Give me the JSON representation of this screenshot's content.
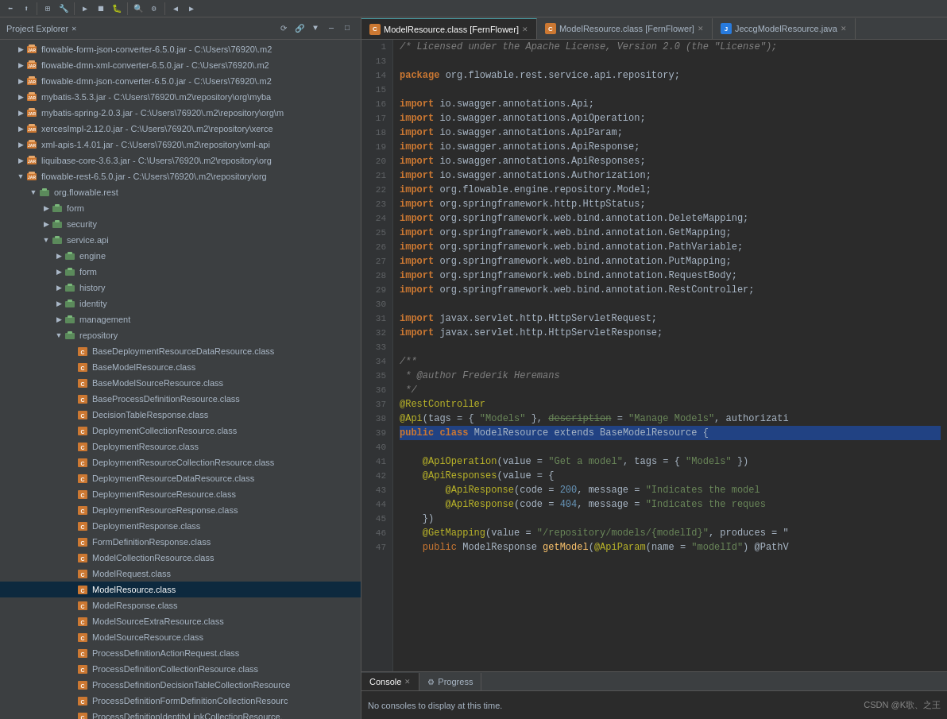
{
  "toolbar": {
    "icons": [
      "⬅",
      "⬆",
      "⊞",
      "▶",
      "⏹",
      "⏺",
      "🔧",
      "⚙",
      "🔍",
      "📋",
      "🔗",
      "⬇",
      "⬆",
      "◀",
      "▶",
      "⏫",
      "⏩"
    ]
  },
  "left_panel": {
    "title": "Project Explorer",
    "items": [
      {
        "id": "jar1",
        "label": "flowable-form-json-converter-6.5.0.jar",
        "path": "C:\\Users\\76920\\.m2",
        "indent": 1,
        "type": "jar",
        "expanded": false
      },
      {
        "id": "jar2",
        "label": "flowable-dmn-xml-converter-6.5.0.jar",
        "path": "C:\\Users\\76920\\.m2",
        "indent": 1,
        "type": "jar",
        "expanded": false
      },
      {
        "id": "jar3",
        "label": "flowable-dmn-json-converter-6.5.0.jar",
        "path": "C:\\Users\\76920\\.m2",
        "indent": 1,
        "type": "jar",
        "expanded": false
      },
      {
        "id": "jar4",
        "label": "mybatis-3.5.3.jar",
        "path": "C:\\Users\\76920\\.m2\\repository\\org\\myba",
        "indent": 1,
        "type": "jar",
        "expanded": false
      },
      {
        "id": "jar5",
        "label": "mybatis-spring-2.0.3.jar",
        "path": "C:\\Users\\76920\\.m2\\repository\\org\\m",
        "indent": 1,
        "type": "jar",
        "expanded": false
      },
      {
        "id": "jar6",
        "label": "xercesImpl-2.12.0.jar",
        "path": "C:\\Users\\76920\\.m2\\repository\\xerce",
        "indent": 1,
        "type": "jar",
        "expanded": false
      },
      {
        "id": "jar7",
        "label": "xml-apis-1.4.01.jar",
        "path": "C:\\Users\\76920\\.m2\\repository\\xml-api",
        "indent": 1,
        "type": "jar",
        "expanded": false
      },
      {
        "id": "jar8",
        "label": "liquibase-core-3.6.3.jar",
        "path": "C:\\Users\\76920\\.m2\\repository\\org",
        "indent": 1,
        "type": "jar",
        "expanded": false
      },
      {
        "id": "jar9",
        "label": "flowable-rest-6.5.0.jar",
        "path": "C:\\Users\\76920\\.m2\\repository\\org",
        "indent": 1,
        "type": "jar",
        "expanded": true
      },
      {
        "id": "pkg1",
        "label": "org.flowable.rest",
        "indent": 2,
        "type": "pkg",
        "expanded": true
      },
      {
        "id": "pkg2",
        "label": "form",
        "indent": 3,
        "type": "pkg",
        "expanded": false
      },
      {
        "id": "pkg3",
        "label": "security",
        "indent": 3,
        "type": "pkg",
        "expanded": false
      },
      {
        "id": "pkg4",
        "label": "service.api",
        "indent": 3,
        "type": "pkg",
        "expanded": true
      },
      {
        "id": "pkg5",
        "label": "engine",
        "indent": 4,
        "type": "pkg",
        "expanded": false
      },
      {
        "id": "pkg6",
        "label": "form",
        "indent": 4,
        "type": "pkg",
        "expanded": false
      },
      {
        "id": "pkg7",
        "label": "history",
        "indent": 4,
        "type": "pkg",
        "expanded": false
      },
      {
        "id": "pkg8",
        "label": "identity",
        "indent": 4,
        "type": "pkg",
        "expanded": false
      },
      {
        "id": "pkg9",
        "label": "management",
        "indent": 4,
        "type": "pkg",
        "expanded": false
      },
      {
        "id": "pkg10",
        "label": "repository",
        "indent": 4,
        "type": "pkg",
        "expanded": true
      },
      {
        "id": "cls1",
        "label": "BaseDeploymentResourceDataResource.class",
        "indent": 5,
        "type": "cls"
      },
      {
        "id": "cls2",
        "label": "BaseModelResource.class",
        "indent": 5,
        "type": "cls"
      },
      {
        "id": "cls3",
        "label": "BaseModelSourceResource.class",
        "indent": 5,
        "type": "cls"
      },
      {
        "id": "cls4",
        "label": "BaseProcessDefinitionResource.class",
        "indent": 5,
        "type": "cls"
      },
      {
        "id": "cls5",
        "label": "DecisionTableResponse.class",
        "indent": 5,
        "type": "cls"
      },
      {
        "id": "cls6",
        "label": "DeploymentCollectionResource.class",
        "indent": 5,
        "type": "cls"
      },
      {
        "id": "cls7",
        "label": "DeploymentResource.class",
        "indent": 5,
        "type": "cls"
      },
      {
        "id": "cls8",
        "label": "DeploymentResourceCollectionResource.class",
        "indent": 5,
        "type": "cls"
      },
      {
        "id": "cls9",
        "label": "DeploymentResourceDataResource.class",
        "indent": 5,
        "type": "cls"
      },
      {
        "id": "cls10",
        "label": "DeploymentResourceResource.class",
        "indent": 5,
        "type": "cls"
      },
      {
        "id": "cls11",
        "label": "DeploymentResourceResponse.class",
        "indent": 5,
        "type": "cls"
      },
      {
        "id": "cls12",
        "label": "DeploymentResponse.class",
        "indent": 5,
        "type": "cls"
      },
      {
        "id": "cls13",
        "label": "FormDefinitionResponse.class",
        "indent": 5,
        "type": "cls"
      },
      {
        "id": "cls14",
        "label": "ModelCollectionResource.class",
        "indent": 5,
        "type": "cls"
      },
      {
        "id": "cls15",
        "label": "ModelRequest.class",
        "indent": 5,
        "type": "cls"
      },
      {
        "id": "cls16",
        "label": "ModelResource.class",
        "indent": 5,
        "type": "cls",
        "selected": true
      },
      {
        "id": "cls17",
        "label": "ModelResponse.class",
        "indent": 5,
        "type": "cls"
      },
      {
        "id": "cls18",
        "label": "ModelSourceExtraResource.class",
        "indent": 5,
        "type": "cls"
      },
      {
        "id": "cls19",
        "label": "ModelSourceResource.class",
        "indent": 5,
        "type": "cls"
      },
      {
        "id": "cls20",
        "label": "ProcessDefinitionActionRequest.class",
        "indent": 5,
        "type": "cls"
      },
      {
        "id": "cls21",
        "label": "ProcessDefinitionCollectionResource.class",
        "indent": 5,
        "type": "cls"
      },
      {
        "id": "cls22",
        "label": "ProcessDefinitionDecisionTableCollectionResource",
        "indent": 5,
        "type": "cls"
      },
      {
        "id": "cls23",
        "label": "ProcessDefinitionFormDefinitionCollectionResourc",
        "indent": 5,
        "type": "cls"
      },
      {
        "id": "cls24",
        "label": "ProcessDefinitionIdentityLinkCollectionResource.",
        "indent": 5,
        "type": "cls"
      }
    ]
  },
  "editor": {
    "tabs": [
      {
        "label": "ModelResource.class [FernFlower]",
        "active": true,
        "type": "orange",
        "closable": true
      },
      {
        "label": "ModelResource.class [FernFlower]",
        "active": false,
        "type": "orange",
        "closable": true
      },
      {
        "label": "JeccgModelResource.java",
        "active": false,
        "type": "blue",
        "closable": true
      }
    ],
    "lines": [
      {
        "num": 1,
        "content": "/* Licensed under the Apache License, Version 2.0 (the \"License\");",
        "type": "comment"
      },
      {
        "num": 13,
        "content": "",
        "type": "blank"
      },
      {
        "num": 14,
        "content": "package org.flowable.rest.service.api.repository;",
        "type": "pkg"
      },
      {
        "num": 15,
        "content": "",
        "type": "blank"
      },
      {
        "num": 16,
        "content": "import io.swagger.annotations.Api;",
        "type": "import"
      },
      {
        "num": 17,
        "content": "import io.swagger.annotations.ApiOperation;",
        "type": "import"
      },
      {
        "num": 18,
        "content": "import io.swagger.annotations.ApiParam;",
        "type": "import"
      },
      {
        "num": 19,
        "content": "import io.swagger.annotations.ApiResponse;",
        "type": "import"
      },
      {
        "num": 20,
        "content": "import io.swagger.annotations.ApiResponses;",
        "type": "import"
      },
      {
        "num": 21,
        "content": "import io.swagger.annotations.Authorization;",
        "type": "import"
      },
      {
        "num": 22,
        "content": "import org.flowable.engine.repository.Model;",
        "type": "import"
      },
      {
        "num": 23,
        "content": "import org.springframework.http.HttpStatus;",
        "type": "import"
      },
      {
        "num": 24,
        "content": "import org.springframework.web.bind.annotation.DeleteMapping;",
        "type": "import"
      },
      {
        "num": 25,
        "content": "import org.springframework.web.bind.annotation.GetMapping;",
        "type": "import"
      },
      {
        "num": 26,
        "content": "import org.springframework.web.bind.annotation.PathVariable;",
        "type": "import"
      },
      {
        "num": 27,
        "content": "import org.springframework.web.bind.annotation.PutMapping;",
        "type": "import"
      },
      {
        "num": 28,
        "content": "import org.springframework.web.bind.annotation.RequestBody;",
        "type": "import"
      },
      {
        "num": 29,
        "content": "import org.springframework.web.bind.annotation.RestController;",
        "type": "import"
      },
      {
        "num": 30,
        "content": "",
        "type": "blank"
      },
      {
        "num": 31,
        "content": "import javax.servlet.http.HttpServletRequest;",
        "type": "import"
      },
      {
        "num": 32,
        "content": "import javax.servlet.http.HttpServletResponse;",
        "type": "import"
      },
      {
        "num": 33,
        "content": "",
        "type": "blank"
      },
      {
        "num": 34,
        "content": "/**",
        "type": "comment_start"
      },
      {
        "num": 35,
        "content": " * @author Frederik Heremans",
        "type": "comment_body"
      },
      {
        "num": 36,
        "content": " */",
        "type": "comment_end"
      },
      {
        "num": 37,
        "content": "@RestController",
        "type": "ann_line"
      },
      {
        "num": 38,
        "content": "@Api(tags = { \"Models\" }, description = \"Manage Models\", authorizati",
        "type": "ann_line2"
      },
      {
        "num": 39,
        "content": "public class ModelResource extends BaseModelResource {",
        "type": "class_decl"
      },
      {
        "num": 40,
        "content": "",
        "type": "blank"
      },
      {
        "num": 41,
        "content": "    @ApiOperation(value = \"Get a model\", tags = { \"Models\" })",
        "type": "ann_line"
      },
      {
        "num": 42,
        "content": "    @ApiResponses(value = {",
        "type": "ann_line"
      },
      {
        "num": 43,
        "content": "        @ApiResponse(code = 200, message = \"Indicates the model",
        "type": "ann_line"
      },
      {
        "num": 44,
        "content": "        @ApiResponse(code = 404, message = \"Indicates the reques",
        "type": "ann_line"
      },
      {
        "num": 45,
        "content": "    })",
        "type": "code"
      },
      {
        "num": 46,
        "content": "    @GetMapping(value = \"/repository/models/{modelId}\", produces = \"",
        "type": "ann_line"
      },
      {
        "num": 47,
        "content": "    public ModelResponse getModel(@ApiParam(name = \"modelId\") @PathV",
        "type": "code"
      }
    ]
  },
  "console": {
    "tabs": [
      {
        "label": "Console",
        "active": true
      },
      {
        "label": "Progress",
        "active": false
      }
    ],
    "status_text": "No consoles to display at this time.",
    "bottom_right": "CSDN @K歌、之王"
  }
}
